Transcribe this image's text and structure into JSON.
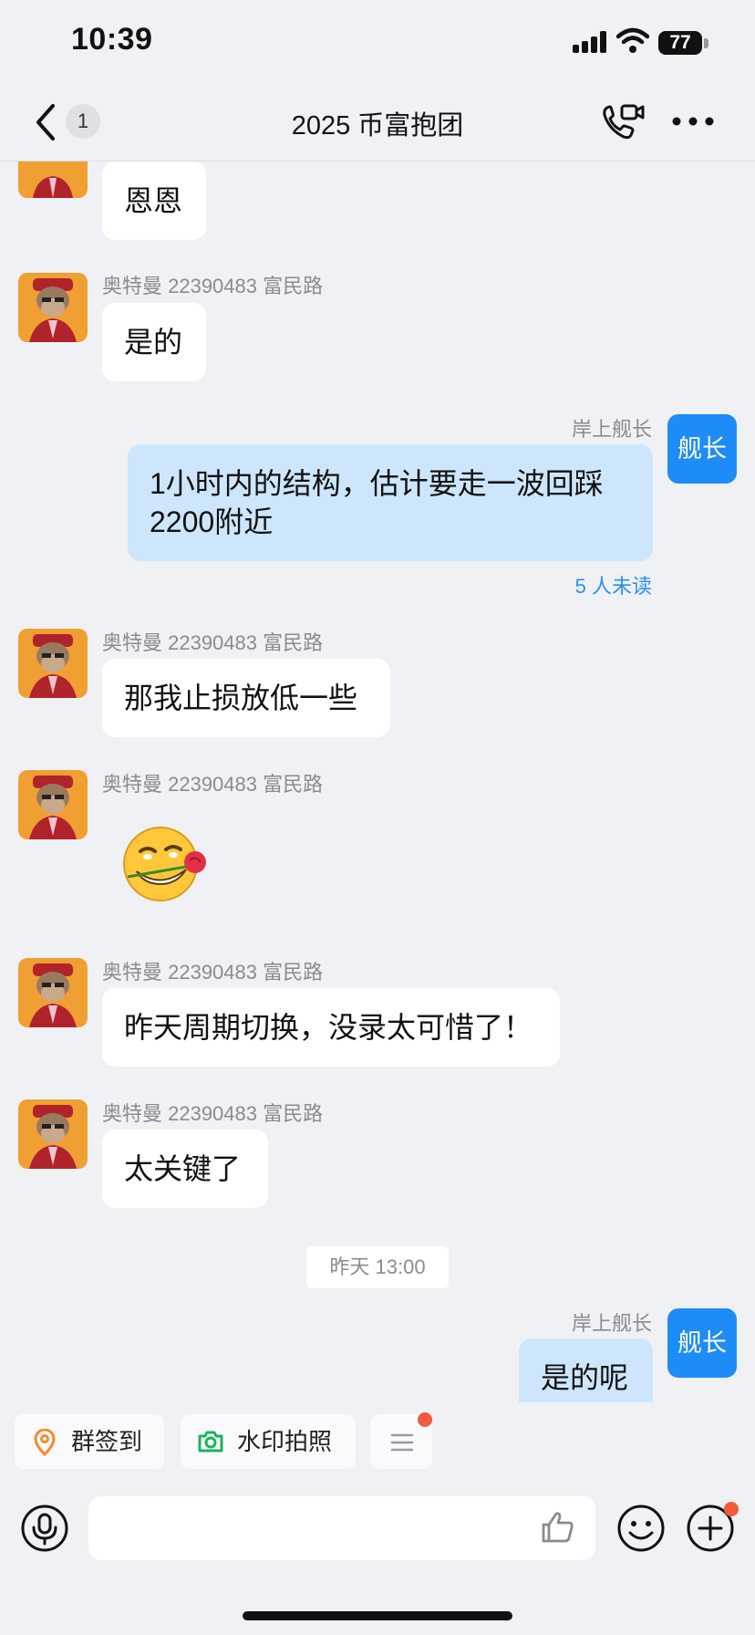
{
  "status_bar": {
    "time": "10:39",
    "battery": "77"
  },
  "nav": {
    "back_count": "1",
    "title": "2025 币富抱团"
  },
  "messages": [
    {
      "text": "恩恩"
    },
    {
      "sender": "奥特曼 22390483 富民路",
      "text": "是的"
    },
    {
      "sender": "岸上舰长",
      "avatar_text": "舰长",
      "text": "1小时内的结构，估计要走一波回踩 2200附近",
      "read_status": "5 人未读"
    },
    {
      "sender": "奥特曼 22390483 富民路",
      "text": "那我止损放低一些"
    },
    {
      "sender": "奥特曼 22390483 富民路",
      "emoji": "rose-in-mouth-grin-emoji"
    },
    {
      "sender": "奥特曼 22390483 富民路",
      "text": "昨天周期切换，没录太可惜了！"
    },
    {
      "sender": "奥特曼 22390483 富民路",
      "text": "太关键了"
    },
    {
      "sender": "岸上舰长",
      "avatar_text": "舰长",
      "text": "是的呢"
    }
  ],
  "time_divider": "昨天 13:00",
  "quick_actions": [
    {
      "label": "群签到",
      "icon": "location-pin-icon",
      "color": "#f28a2a"
    },
    {
      "label": "水印拍照",
      "icon": "camera-icon",
      "color": "#19b35a"
    },
    {
      "label": "",
      "icon": "menu-lines-icon"
    }
  ],
  "composer": {
    "placeholder": ""
  },
  "colors": {
    "accent": "#1e8cf8",
    "mine_bubble": "#cde6fc",
    "avatar_bg": "#f0a032",
    "badge": "#f25a3b"
  }
}
